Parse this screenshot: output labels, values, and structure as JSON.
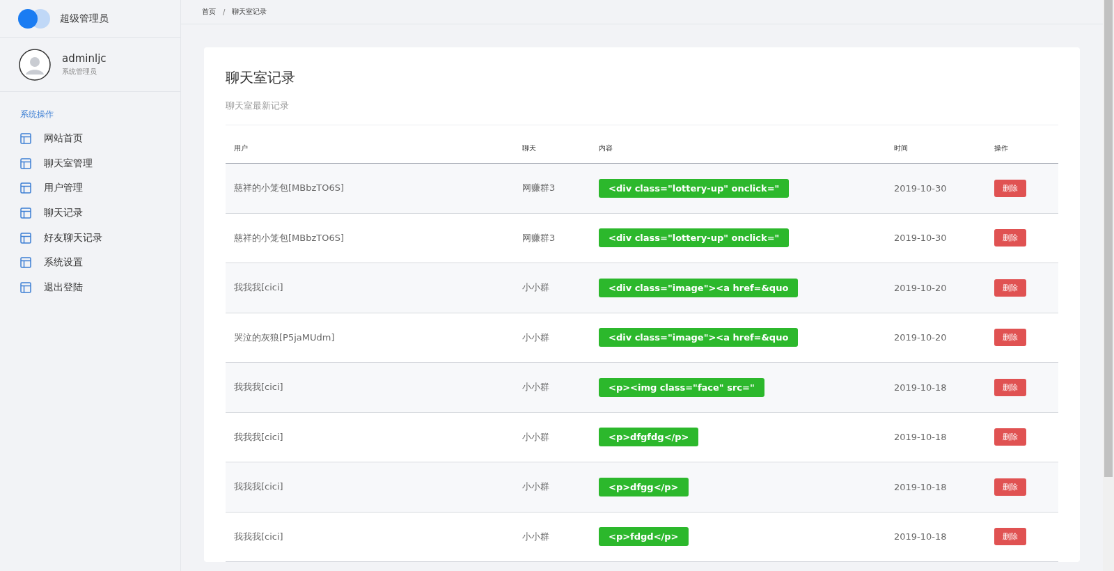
{
  "brand": {
    "title": "超级管理员"
  },
  "profile": {
    "name": "adminljc",
    "role": "系统管理员"
  },
  "sidebar": {
    "section": "系统操作",
    "items": [
      {
        "label": "网站首页"
      },
      {
        "label": "聊天室管理"
      },
      {
        "label": "用户管理"
      },
      {
        "label": "聊天记录"
      },
      {
        "label": "好友聊天记录"
      },
      {
        "label": "系统设置"
      },
      {
        "label": "退出登陆"
      }
    ]
  },
  "breadcrumb": [
    {
      "label": "首页"
    },
    {
      "label": "聊天室记录"
    }
  ],
  "breadcrumb_separator": "/",
  "card": {
    "title": "聊天室记录",
    "subtitle": "聊天室最新记录"
  },
  "table": {
    "columns": [
      "用户",
      "聊天",
      "内容",
      "时间",
      "操作"
    ],
    "rows": [
      {
        "user": "慈祥的小笼包[MBbzTO6S]",
        "chat": "网赚群3",
        "content": "<div class=\"lottery-up\" onclick=\"",
        "time": "2019-10-30",
        "action": "删除"
      },
      {
        "user": "慈祥的小笼包[MBbzTO6S]",
        "chat": "网赚群3",
        "content": "<div class=\"lottery-up\" onclick=\"",
        "time": "2019-10-30",
        "action": "删除"
      },
      {
        "user": "我我我[cici]",
        "chat": "小小群",
        "content": "<div class=\"image\"><a href=&quo",
        "time": "2019-10-20",
        "action": "删除"
      },
      {
        "user": "哭泣的灰狼[P5jaMUdm]",
        "chat": "小小群",
        "content": "<div class=\"image\"><a href=&quo",
        "time": "2019-10-20",
        "action": "删除"
      },
      {
        "user": "我我我[cici]",
        "chat": "小小群",
        "content": "<p><img class=\"face\" src=\"",
        "time": "2019-10-18",
        "action": "删除"
      },
      {
        "user": "我我我[cici]",
        "chat": "小小群",
        "content": "<p>dfgfdg</p>",
        "time": "2019-10-18",
        "action": "删除"
      },
      {
        "user": "我我我[cici]",
        "chat": "小小群",
        "content": "<p>dfgg</p>",
        "time": "2019-10-18",
        "action": "删除"
      },
      {
        "user": "我我我[cici]",
        "chat": "小小群",
        "content": "<p>fdgd</p>",
        "time": "2019-10-18",
        "action": "删除"
      }
    ]
  }
}
